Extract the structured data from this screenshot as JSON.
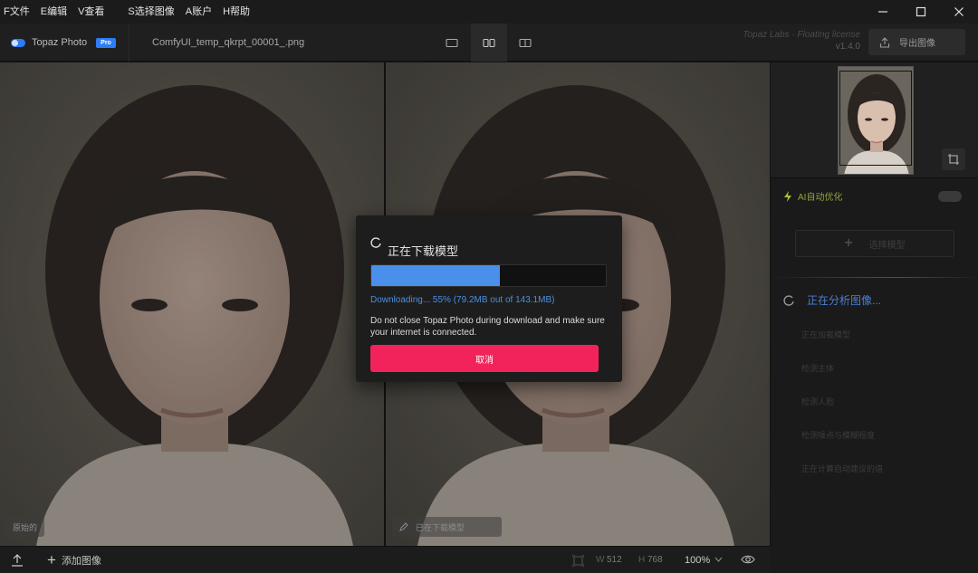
{
  "menu": [
    {
      "key": "file",
      "label": "F文件"
    },
    {
      "key": "edit",
      "label": "E编辑"
    },
    {
      "key": "view",
      "label": "V查看"
    },
    {
      "key": "select_image",
      "label": "S选择图像"
    },
    {
      "key": "account",
      "label": "A账户"
    },
    {
      "key": "help",
      "label": "H帮助"
    }
  ],
  "toolbar": {
    "brand_name": "Topaz Photo",
    "brand_badge": "Pro",
    "file_name": "ComfyUI_temp_qkrpt_00001_.png",
    "app_info_line1": "Topaz Labs · Floating license",
    "app_info_version": "v1.4.0",
    "export_label": "导出图像"
  },
  "panes": {
    "left_tag": "原始的",
    "right_tag": "已在下载模型"
  },
  "panel": {
    "ai_label": "AI自动优化",
    "select_model_label": "选择模型",
    "analyzing_label": "正在分析图像...",
    "steps": [
      "正在加载模型",
      "检测主体",
      "检测人脸",
      "检测噪点与模糊程度",
      "正在计算自动建议的值"
    ]
  },
  "statusbar": {
    "add_image_label": "添加图像",
    "width_label": "W",
    "width_value": "512",
    "height_label": "H",
    "height_value": "768",
    "zoom_value": "100%"
  },
  "dialog": {
    "title": "正在下载模型",
    "progress_percent": 55,
    "status": "Downloading... 55% (79.2MB out of 143.1MB)",
    "note": "Do not close Topaz Photo during download and make sure your internet is connected.",
    "cancel_label": "取消"
  },
  "colors": {
    "accent_blue": "#4a8fea",
    "cancel_red": "#f2235a",
    "ai_green": "#8fa53a",
    "brand_blue": "#2e7cf6"
  }
}
